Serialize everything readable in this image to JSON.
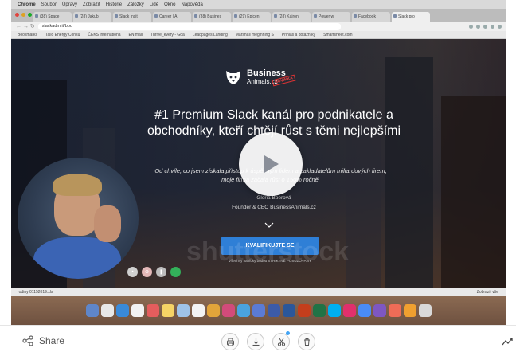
{
  "browser": {
    "menubar": [
      "Chrome",
      "Soubor",
      "Úpravy",
      "Zobrazit",
      "Historie",
      "Záložky",
      "Lidé",
      "Okno",
      "Nápověda"
    ],
    "tabs": [
      "(38) Space",
      "(28) Jakub",
      "Slack Insit",
      "Career | A",
      "(38) Busines",
      "(29) Epicen",
      "(28) Kairon",
      "Power w",
      "Facebook",
      "Slack pro"
    ],
    "address": "slackadm.it/boo",
    "bookmarks": [
      "Bookmarks",
      "Tallo Energy Consu",
      "ČEKS internationa",
      "EN mail",
      "Thrive_every - Goa",
      "Leadpages Landing",
      "Marshall meginning S",
      "Přihlaš a dotazníky",
      "Smartsheet.com"
    ],
    "download_file": "rodiny 01152019.xls",
    "download_right": "Zobrazit vše"
  },
  "hero": {
    "logo_name": "Business",
    "logo_sub": "Animals.cz",
    "logo_stamp": "NOVINKA",
    "headline": "#1 Premium Slack kanál pro podnikatele a obchodníky, kteří chtějí růst s těmi nejlepšími",
    "subtext": "Od chvíle, co jsem získala přístup k úspěšným lidem a zakladatelům miliardových firem, moje firma začala růst o 150% ročně.",
    "author_name": "Gloria Boerová",
    "author_title": "Founder & CEO BusinessAnimals.cz",
    "cta": "KVALIFIKUJTE SE",
    "cta_note": "Všechny nabídky budou STRIKTNĚ POSUZOVANY"
  },
  "watermark": "shutterstock",
  "toolbar": {
    "share_label": "Share"
  },
  "icons": {
    "share": "share-icon",
    "print": "print-icon",
    "download": "download-icon",
    "cut": "scissors-icon",
    "delete": "trash-icon",
    "stats": "trending-icon",
    "play": "play-icon"
  },
  "colors": {
    "cta": "#2f7fd6",
    "badge": "#42a4f5"
  }
}
